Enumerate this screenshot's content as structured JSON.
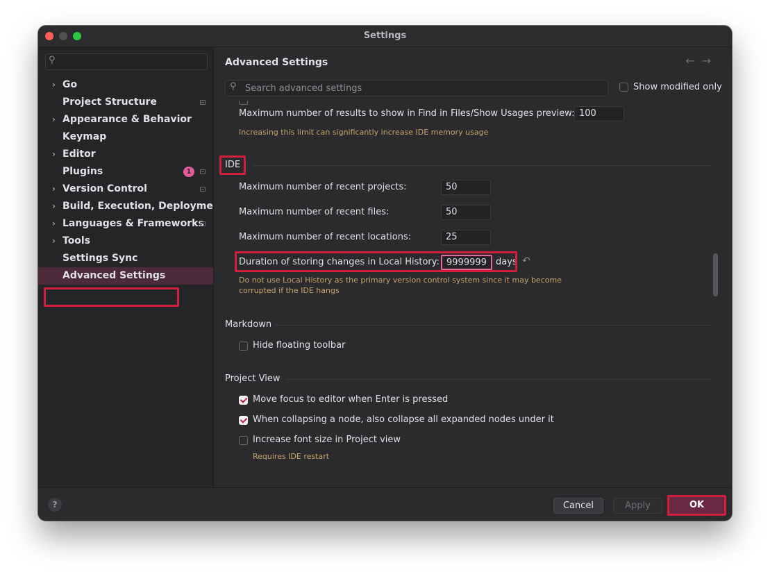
{
  "window": {
    "title": "Settings"
  },
  "sidebar": {
    "search_placeholder": "",
    "items": [
      {
        "label": "Go",
        "chevron": true,
        "mark": false
      },
      {
        "label": "Project Structure",
        "chevron": false,
        "mark": true
      },
      {
        "label": "Appearance & Behavior",
        "chevron": true,
        "mark": false
      },
      {
        "label": "Keymap",
        "chevron": false,
        "mark": false
      },
      {
        "label": "Editor",
        "chevron": true,
        "mark": false
      },
      {
        "label": "Plugins",
        "chevron": false,
        "mark": true,
        "badge": "1"
      },
      {
        "label": "Version Control",
        "chevron": true,
        "mark": true
      },
      {
        "label": "Build, Execution, Deployment",
        "chevron": true,
        "mark": false
      },
      {
        "label": "Languages & Frameworks",
        "chevron": true,
        "mark": true
      },
      {
        "label": "Tools",
        "chevron": true,
        "mark": false
      },
      {
        "label": "Settings Sync",
        "chevron": false,
        "mark": false
      },
      {
        "label": "Advanced Settings",
        "chevron": false,
        "mark": false,
        "selected": true
      }
    ]
  },
  "content": {
    "title": "Advanced Settings",
    "search_placeholder": "Search advanced settings",
    "show_modified_only": "Show modified only",
    "find_results": {
      "label": "Maximum number of results to show in Find in Files/Show Usages preview:",
      "value": "100",
      "hint": "Increasing this limit can significantly increase IDE memory usage"
    },
    "ide": {
      "title": "IDE",
      "recent_projects": {
        "label": "Maximum number of recent projects:",
        "value": "50"
      },
      "recent_files": {
        "label": "Maximum number of recent files:",
        "value": "50"
      },
      "recent_locations": {
        "label": "Maximum number of recent locations:",
        "value": "25"
      },
      "local_history": {
        "label": "Duration of storing changes in Local History:",
        "value": "9999999",
        "unit": "days",
        "hint_line1": "Do not use Local History as the primary version control system since it may become",
        "hint_line2": "corrupted if the IDE hangs"
      }
    },
    "markdown": {
      "title": "Markdown",
      "hide_floating_toolbar": "Hide floating toolbar"
    },
    "project_view": {
      "title": "Project View",
      "move_focus": "Move focus to editor when Enter is pressed",
      "collapse_nodes": "When collapsing a node, also collapse all expanded nodes under it",
      "increase_font": "Increase font size in Project view",
      "increase_font_hint": "Requires IDE restart"
    }
  },
  "footer": {
    "help": "?",
    "cancel": "Cancel",
    "apply": "Apply",
    "ok": "OK"
  },
  "colors": {
    "accent": "#d11f3c",
    "selection": "#4c2a3a",
    "hint": "#c9a36b",
    "badge": "#e55b9c"
  }
}
